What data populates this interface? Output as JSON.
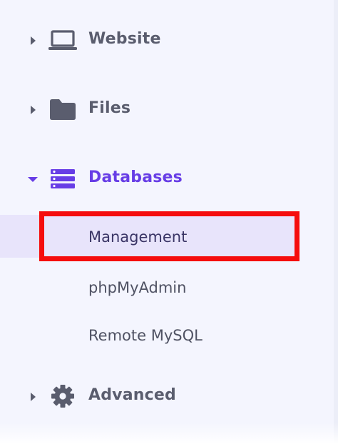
{
  "nav": {
    "groups": [
      {
        "id": "website",
        "label": "Website",
        "icon": "laptop-icon",
        "expanded": false
      },
      {
        "id": "files",
        "label": "Files",
        "icon": "folder-icon",
        "expanded": false
      },
      {
        "id": "databases",
        "label": "Databases",
        "icon": "database-icon",
        "expanded": true
      },
      {
        "id": "advanced",
        "label": "Advanced",
        "icon": "gear-icon",
        "expanded": false
      }
    ],
    "database_items": [
      {
        "label": "Management",
        "selected": true
      },
      {
        "label": "phpMyAdmin",
        "selected": false
      },
      {
        "label": "Remote MySQL",
        "selected": false
      }
    ]
  },
  "colors": {
    "accent": "#673de6",
    "text": "#5a5d6e",
    "selected_bg": "#e8e4fb",
    "sidebar_bg": "#f4f5fe",
    "highlight_frame": "#f50d0d"
  }
}
